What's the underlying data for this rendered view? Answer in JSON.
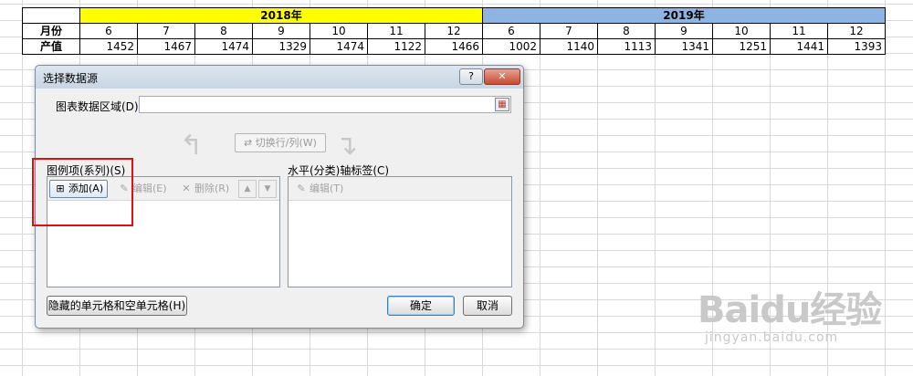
{
  "table": {
    "year_headers": [
      "2018年",
      "2019年"
    ],
    "month_label": "月份",
    "value_label": "产值",
    "months_2018": [
      "6",
      "7",
      "8",
      "9",
      "10",
      "11",
      "12"
    ],
    "months_2019": [
      "6",
      "7",
      "8",
      "9",
      "10",
      "11",
      "12"
    ],
    "values_2018": [
      "1452",
      "1467",
      "1474",
      "1329",
      "1474",
      "1122",
      "1466"
    ],
    "values_2019": [
      "1002",
      "1140",
      "1113",
      "1341",
      "1251",
      "1441",
      "1393"
    ]
  },
  "dialog": {
    "title": "选择数据源",
    "help_label": "?",
    "close_label": "✕",
    "range_label": "图表数据区域(D):",
    "range_value": "",
    "switch_label": "切换行/列(W)",
    "legend_label": "图例项(系列)(S)",
    "axis_label": "水平(分类)轴标签(C)",
    "add_label": "添加(A)",
    "edit_label": "编辑(E)",
    "delete_label": "删除(R)",
    "axis_edit_label": "编辑(T)",
    "hidden_cells_label": "隐藏的单元格和空单元格(H)",
    "ok_label": "确定",
    "cancel_label": "取消"
  },
  "icons": {
    "add": "add-series-icon",
    "edit": "edit-icon",
    "delete": "delete-icon",
    "up": "move-up-icon",
    "down": "move-down-icon",
    "switch": "switch-icon"
  },
  "colors": {
    "year_2018_bg": "#ffff00",
    "year_2019_bg": "#8db4e2",
    "highlight": "#e01010"
  },
  "watermark": {
    "logo": "Baidu经验",
    "site": "jingyan.baidu.com"
  }
}
